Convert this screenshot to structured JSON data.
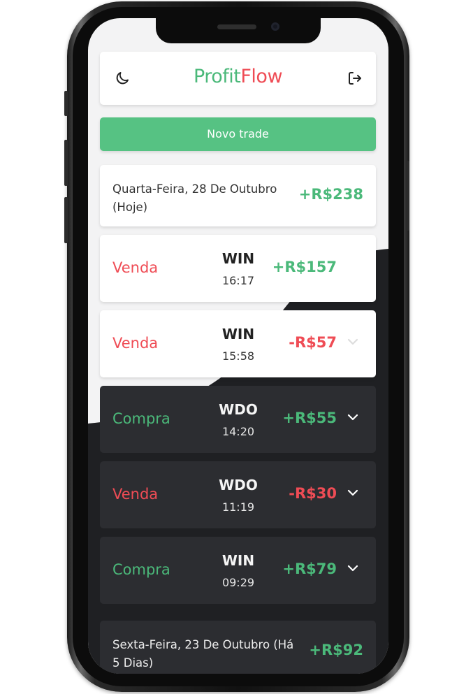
{
  "app": {
    "brand_part1": "Profit",
    "brand_part2": "Flow",
    "colors": {
      "green": "#4bb97a",
      "red": "#ef4c55",
      "button": "#56c283",
      "dark_card": "#2c2d31"
    },
    "icons": {
      "theme_toggle": "moon-icon",
      "logout": "logout-icon",
      "expand": "chevron-down-icon"
    }
  },
  "actions": {
    "new_trade_label": "Novo trade"
  },
  "days": [
    {
      "date_label": "Quarta-Feira, 28 De Outubro (Hoje)",
      "total": "+R$238",
      "trades": [
        {
          "side": "Venda",
          "asset": "WIN",
          "time": "16:17",
          "result": "+R$157"
        },
        {
          "side": "Venda",
          "asset": "WIN",
          "time": "15:58",
          "result": "-R$57"
        },
        {
          "side": "Compra",
          "asset": "WDO",
          "time": "14:20",
          "result": "+R$55"
        },
        {
          "side": "Venda",
          "asset": "WDO",
          "time": "11:19",
          "result": "-R$30"
        },
        {
          "side": "Compra",
          "asset": "WIN",
          "time": "09:29",
          "result": "+R$79"
        }
      ]
    },
    {
      "date_label": "Sexta-Feira, 23 De Outubro (Há 5 Dias)",
      "total": "+R$92",
      "trades": []
    }
  ]
}
